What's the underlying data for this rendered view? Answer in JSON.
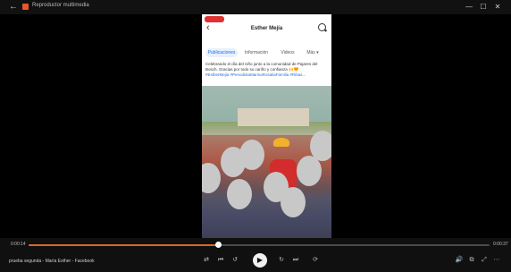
{
  "titlebar": {
    "title": "Reproductor multimedia",
    "back_icon": "back-arrow-icon",
    "controls": [
      {
        "name": "minimize-icon",
        "glyph": "—"
      },
      {
        "name": "maximize-icon",
        "glyph": "☐"
      },
      {
        "name": "close-icon",
        "glyph": "✕"
      }
    ]
  },
  "video": {
    "facebook": {
      "page_name": "Esther Mejía",
      "tabs": [
        "Publicaciones",
        "Información",
        "Videos",
        "Más ▾"
      ],
      "active_tab": 0,
      "caption": "Celebrando el día del niño junto a la comunidad de Pajares del Bosch. Gracias por todo su cariño y confianza",
      "caption_tail": "#EstherMejia #PeriodistaMarinaRosaliaFamilia #Ribas..."
    }
  },
  "player": {
    "time_current": "0:00:14",
    "time_total": "0:00:37",
    "progress": 0.41,
    "media_title": "prueba segunda - María Esther - Facebook",
    "accent_color": "#d56a2a",
    "center_controls": [
      {
        "name": "shuffle-icon",
        "glyph": "⇄"
      },
      {
        "name": "previous-icon",
        "glyph": "⏮"
      },
      {
        "name": "rewind-10-icon",
        "glyph": "↺"
      },
      {
        "name": "forward-30-icon",
        "glyph": "↻"
      },
      {
        "name": "next-icon",
        "glyph": "⏭"
      },
      {
        "name": "repeat-icon",
        "glyph": "⟳"
      }
    ],
    "play_glyph": "▶",
    "right_controls": [
      {
        "name": "volume-icon",
        "glyph": "🔊"
      },
      {
        "name": "cast-icon",
        "glyph": "⧉"
      },
      {
        "name": "fullscreen-icon",
        "glyph": "⤢"
      },
      {
        "name": "more-icon",
        "glyph": "⋯"
      }
    ]
  }
}
